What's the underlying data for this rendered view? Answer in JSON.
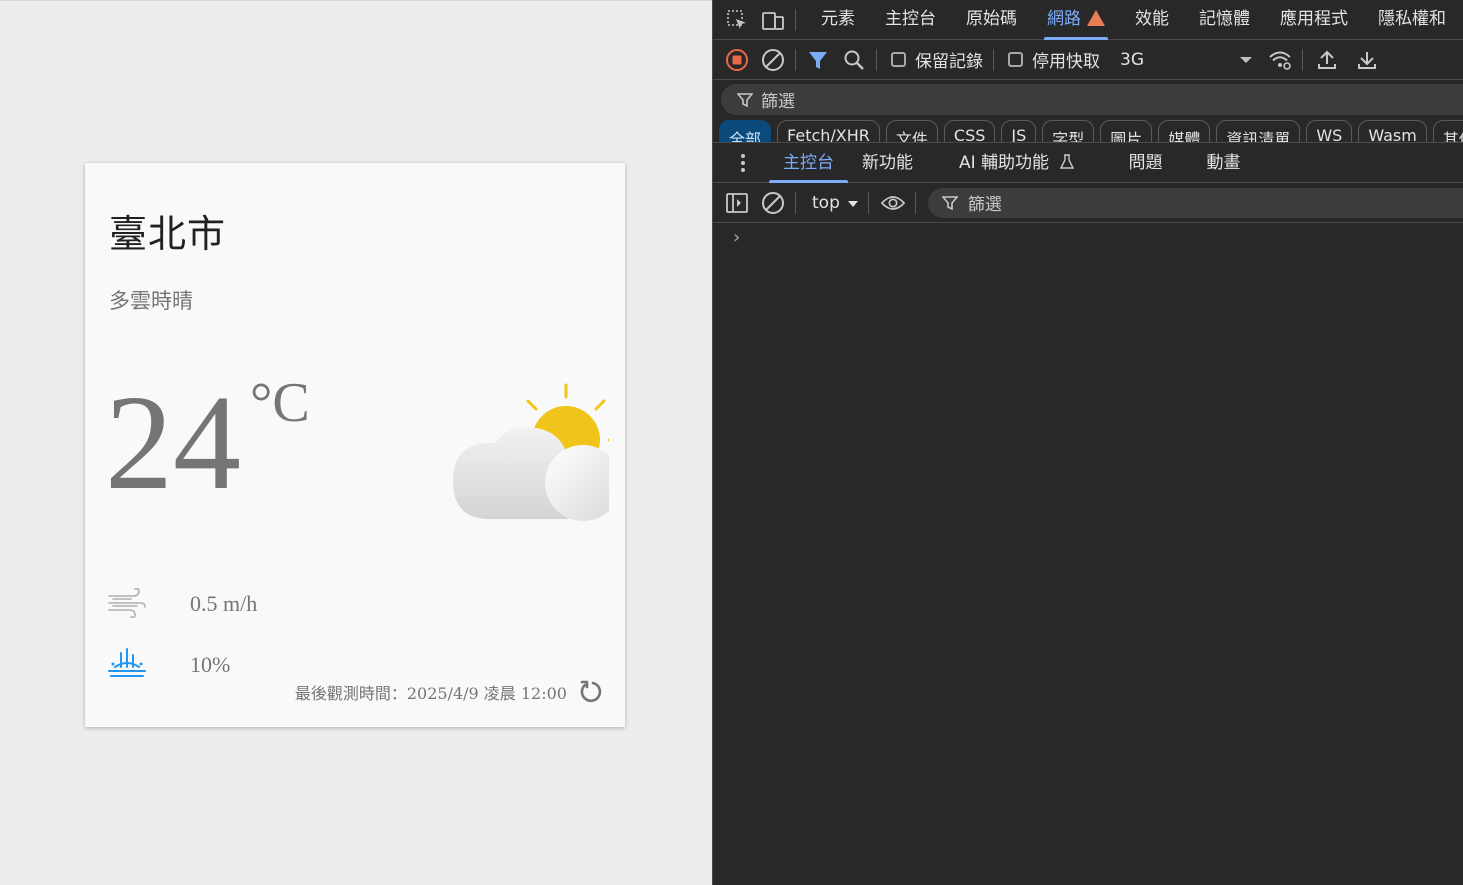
{
  "weather": {
    "city": "臺北市",
    "description": "多雲時晴",
    "temperature": "24",
    "unit": "°C",
    "wind": "0.5 m/h",
    "rain": "10%",
    "last_observed": "最後觀測時間：2025/4/9 凌晨 12:00",
    "icons": {
      "weather": "partly-cloudy-day-icon",
      "wind": "wind-icon",
      "rain": "rain-drops-icon",
      "refresh": "refresh-icon"
    },
    "colors": {
      "sun": "#f0c419",
      "rain": "#2196f3",
      "text": "#757575",
      "card": "#f9f9f9"
    }
  },
  "devtools": {
    "top_tabs": [
      "元素",
      "主控台",
      "原始碼",
      "網路",
      "效能",
      "記憶體",
      "應用程式",
      "隱私權和"
    ],
    "active_top_tab": "網路",
    "network": {
      "preserve_log": "保留記錄",
      "disable_cache": "停用快取",
      "throttle": "3G",
      "filter_placeholder": "篩選"
    },
    "type_filters": [
      "全部",
      "Fetch/XHR",
      "文件",
      "CSS",
      "JS",
      "字型",
      "圖片",
      "媒體",
      "資訊清單",
      "WS",
      "Wasm",
      "其他"
    ],
    "drawer_tabs": [
      "主控台",
      "新功能",
      "AI 輔助功能",
      "問題",
      "動畫"
    ],
    "console": {
      "context": "top",
      "filter_placeholder": "篩選",
      "prompt": "›"
    },
    "accent": "#7cacf8"
  }
}
